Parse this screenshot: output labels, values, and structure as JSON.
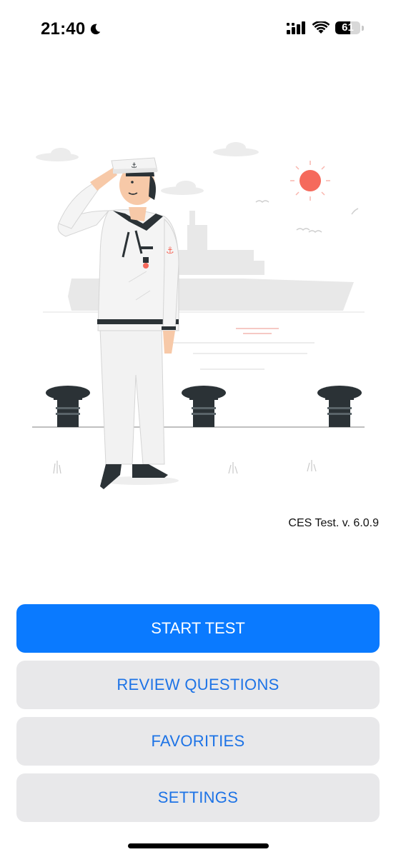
{
  "status_bar": {
    "time": "21:40",
    "battery_level": "61",
    "battery_percent": 61
  },
  "illustration": {
    "description_icon": "sailor-saluting-illustration"
  },
  "version": "CES Test. v. 6.0.9",
  "menu": {
    "start_test": "START TEST",
    "review_questions": "REVIEW QUESTIONS",
    "favorities": "FAVORITIES",
    "settings": "SETTINGS"
  },
  "colors": {
    "primary": "#0a7aff",
    "secondary_bg": "#e8e8ea",
    "secondary_text": "#1d73e6"
  }
}
